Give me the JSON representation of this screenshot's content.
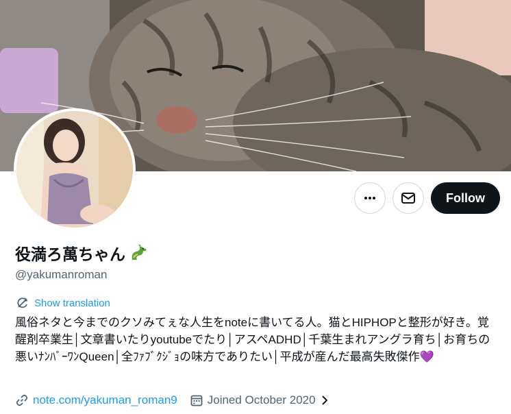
{
  "profile": {
    "display_name": "役満ろ萬ちゃん",
    "name_emoji_icon": "dragon-icon",
    "handle": "@yakumanroman",
    "bio": "風俗ネタと今までのクソみてぇな人生をnoteに書いてる人。猫とHIPHOPと整形が好き。覚醒剤卒業生│文章書いたりyoutubeでたり│アスペADHD│千葉生まれアングラ育ち│お育ちの悪いﾅﾝﾊﾞｰﾜﾝQueen│全ﾌｧﾌﾞｸｼﾞｮの味方でありたい│平成が産んだ最高失敗傑作💜",
    "website": "note.com/yakuman_roman9",
    "joined": "Joined October 2020"
  },
  "actions": {
    "more_icon": "more-icon",
    "message_icon": "envelope-icon",
    "follow_label": "Follow"
  },
  "translation": {
    "label": "Show translation",
    "icon": "translate-icon"
  },
  "colors": {
    "accent": "#1d9bf0",
    "text": "#0f1419",
    "secondary": "#536471",
    "follow_bg": "#0f1419"
  }
}
